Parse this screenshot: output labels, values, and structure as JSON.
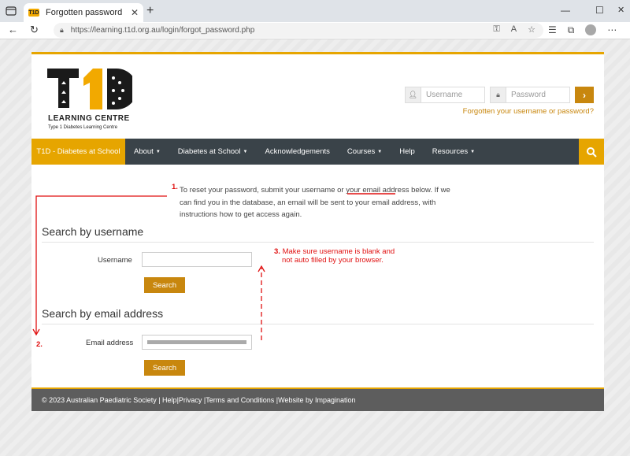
{
  "browser": {
    "tab_title": "Forgotten password",
    "url": "https://learning.t1d.org.au/login/forgot_password.php",
    "favicon_text": "T1D"
  },
  "header": {
    "logo_title": "LEARNING CENTRE",
    "logo_subtitle": "Type 1 Diabetes Learning Centre",
    "username_placeholder": "Username",
    "password_placeholder": "Password",
    "forgot_link": "Forgotten your username or password?"
  },
  "nav": {
    "brand": "T1D - Diabetes at School",
    "items": [
      {
        "label": "About",
        "dropdown": true
      },
      {
        "label": "Diabetes at School",
        "dropdown": true
      },
      {
        "label": "Acknowledgements",
        "dropdown": false
      },
      {
        "label": "Courses",
        "dropdown": true
      },
      {
        "label": "Help",
        "dropdown": false
      },
      {
        "label": "Resources",
        "dropdown": true
      }
    ]
  },
  "main": {
    "intro": "To reset your password, submit your username or your email address below. If we can find you in the database, an email will be sent to your email address, with instructions how to get access again.",
    "username_section": {
      "heading": "Search by username",
      "label": "Username",
      "button": "Search"
    },
    "email_section": {
      "heading": "Search by email address",
      "label": "Email address",
      "button": "Search"
    }
  },
  "footer": {
    "text": "© 2023 Australian Paediatric Society | Help|Privacy |Terms and Conditions |Website by Impagination"
  },
  "annotations": {
    "one": "1.",
    "two": "2.",
    "three": "3.",
    "three_text_line1": "Make sure username is blank and",
    "three_text_line2": "not auto filled by your browser.",
    "color": "#e01010"
  },
  "colors": {
    "accent": "#e6a500",
    "button": "#c8870e",
    "nav_bg": "#3a4349",
    "footer_bg": "#5d5d5d"
  }
}
